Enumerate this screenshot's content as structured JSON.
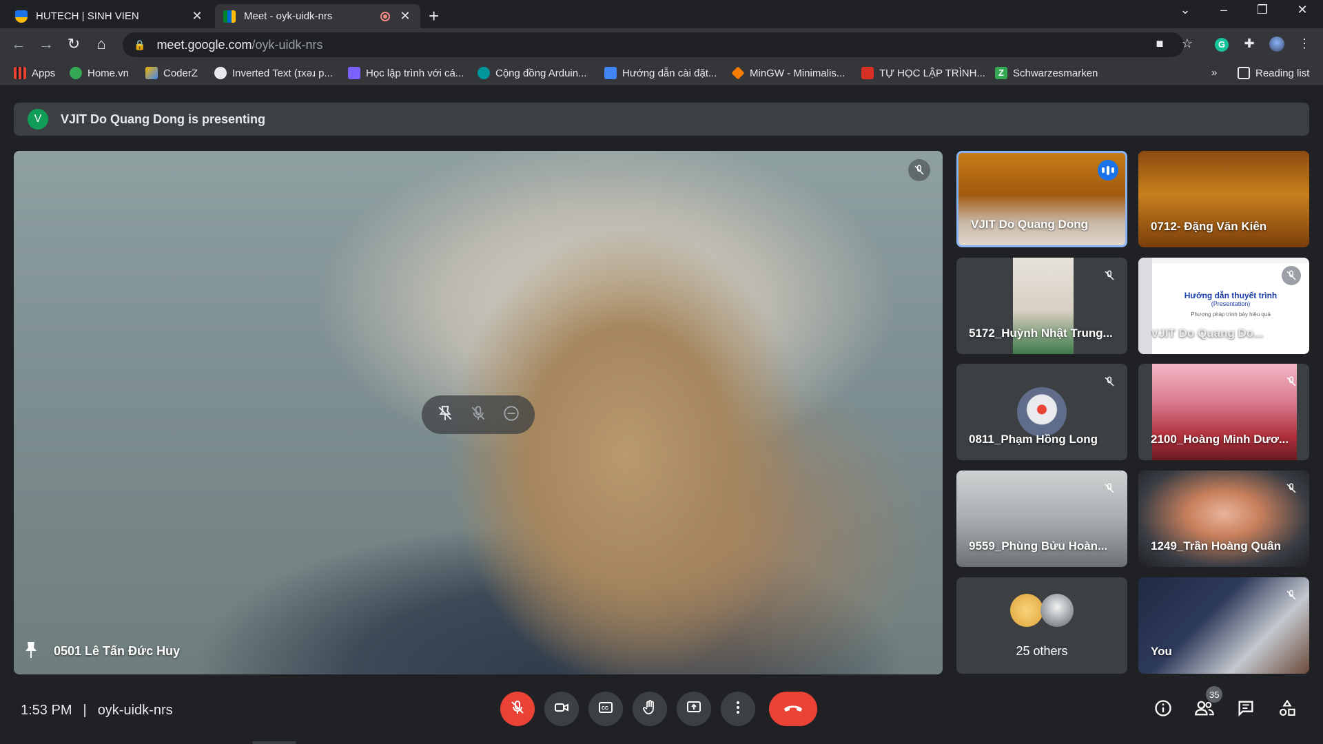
{
  "browser": {
    "tabs": [
      {
        "title": "HUTECH | SINH VIEN",
        "active": false
      },
      {
        "title": "Meet - oyk-uidk-nrs",
        "active": true,
        "recording": true
      }
    ],
    "url": {
      "host": "meet.google.com",
      "path": "/oyk-uidk-nrs"
    },
    "bookmarks": [
      {
        "label": "Apps",
        "icon": "apps-grid-icon",
        "color": "#4285f4"
      },
      {
        "label": "Home.vn",
        "icon": "home-vn-icon",
        "color": "#34a853"
      },
      {
        "label": "CoderZ",
        "icon": "coderz-icon",
        "color": "#f4b400"
      },
      {
        "label": "Inverted Text (ɪxəɹ p...",
        "icon": "globe-icon",
        "color": "#e8eaed"
      },
      {
        "label": "Học lập trình với cá...",
        "icon": "course-icon",
        "color": "#7b61ff"
      },
      {
        "label": "Cộng đồng Arduin...",
        "icon": "arduino-icon",
        "color": "#00979c"
      },
      {
        "label": "Hướng dẫn cài đặt...",
        "icon": "guide-icon",
        "color": "#4285f4"
      },
      {
        "label": "MinGW - Minimalis...",
        "icon": "mingw-icon",
        "color": "#f57c00"
      },
      {
        "label": "TỰ HỌC LẬP TRÌNH...",
        "icon": "tuhoc-icon",
        "color": "#d93025"
      },
      {
        "label": "Schwarzesmarken",
        "icon": "z-icon",
        "color": "#34a853"
      }
    ],
    "more_label": "»",
    "reading_list": "Reading list"
  },
  "meet": {
    "presenting": {
      "initial": "V",
      "text": "VJIT Do Quang Dong is presenting"
    },
    "main": {
      "name": "0501 Lê Tấn Đức Huy"
    },
    "tiles": [
      {
        "name": "VJIT Do Quang Dong",
        "speaking": true
      },
      {
        "name": "0712- Đặng Văn Kiên"
      },
      {
        "name": "5172_Huỳnh Nhật Trung..."
      },
      {
        "name": "VJIT Do Quang Do...",
        "slide_title": "Hướng dẫn thuyết trình",
        "slide_sub": "(Presentation)",
        "slide_sub2": "Phương pháp trình bày hiệu quả"
      },
      {
        "name": "0811_Phạm Hồng Long"
      },
      {
        "name": "2100_Hoàng Minh Dươ..."
      },
      {
        "name": "9559_Phùng Bửu Hoàn..."
      },
      {
        "name": "1249_Trần Hoàng Quân"
      },
      {
        "name": "25 others"
      },
      {
        "name": "You"
      }
    ],
    "time": "1:53 PM",
    "code": "oyk-uidk-nrs",
    "participants_count": "35",
    "colors": {
      "accent": "#8ab4f8",
      "danger": "#ea4335",
      "speaking": "#1a73e8"
    }
  }
}
